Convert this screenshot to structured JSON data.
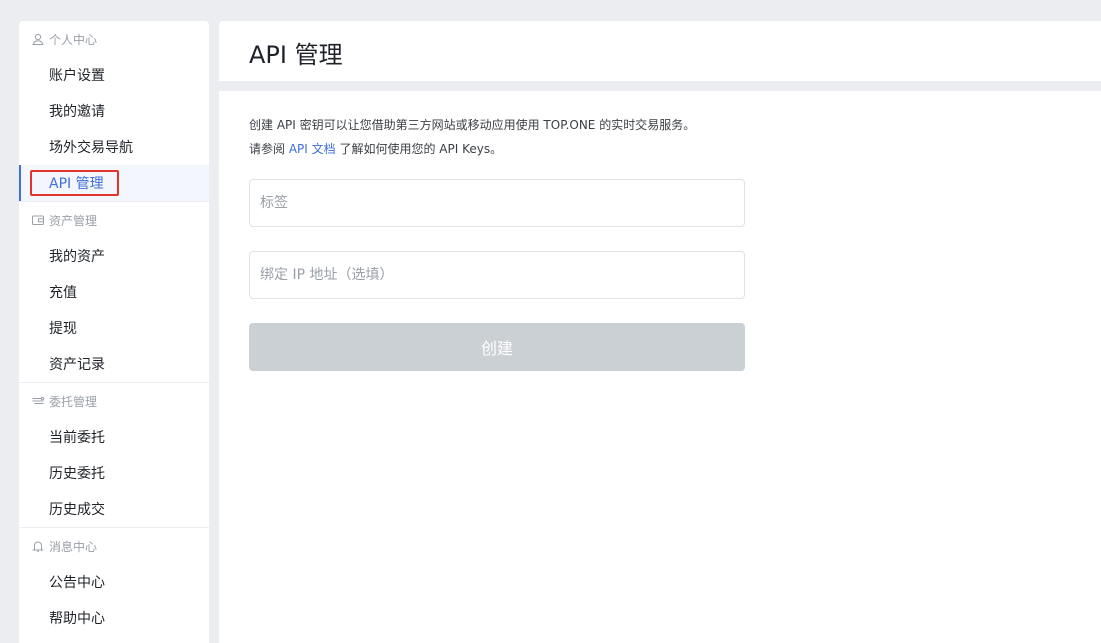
{
  "sidebar": {
    "groups": [
      {
        "title": "个人中心",
        "icon": "user-icon",
        "items": [
          {
            "label": "账户设置"
          },
          {
            "label": "我的邀请"
          },
          {
            "label": "场外交易导航"
          },
          {
            "label": "API 管理",
            "active": true
          }
        ]
      },
      {
        "title": "资产管理",
        "icon": "wallet-icon",
        "items": [
          {
            "label": "我的资产"
          },
          {
            "label": "充值"
          },
          {
            "label": "提现"
          },
          {
            "label": "资产记录"
          }
        ]
      },
      {
        "title": "委托管理",
        "icon": "orders-icon",
        "items": [
          {
            "label": "当前委托"
          },
          {
            "label": "历史委托"
          },
          {
            "label": "历史成交"
          }
        ]
      },
      {
        "title": "消息中心",
        "icon": "bell-icon",
        "items": [
          {
            "label": "公告中心"
          },
          {
            "label": "帮助中心"
          }
        ]
      }
    ]
  },
  "header": {
    "title": "API 管理"
  },
  "main": {
    "description_line1": "创建 API 密钥可以让您借助第三方网站或移动应用使用 TOP.ONE 的实时交易服务。",
    "description_line2_prefix": "请参阅 ",
    "description_link": "API 文档",
    "description_line2_suffix": " 了解如何使用您的 API Keys。",
    "label_field": {
      "placeholder": "标签",
      "value": ""
    },
    "ip_field": {
      "placeholder": "绑定 IP 地址（选填）",
      "value": ""
    },
    "create_button": {
      "label": "创建"
    }
  },
  "colors": {
    "accent": "#3f6fd8",
    "highlight": "#e0352b",
    "button_disabled": "#cbd0d5"
  }
}
